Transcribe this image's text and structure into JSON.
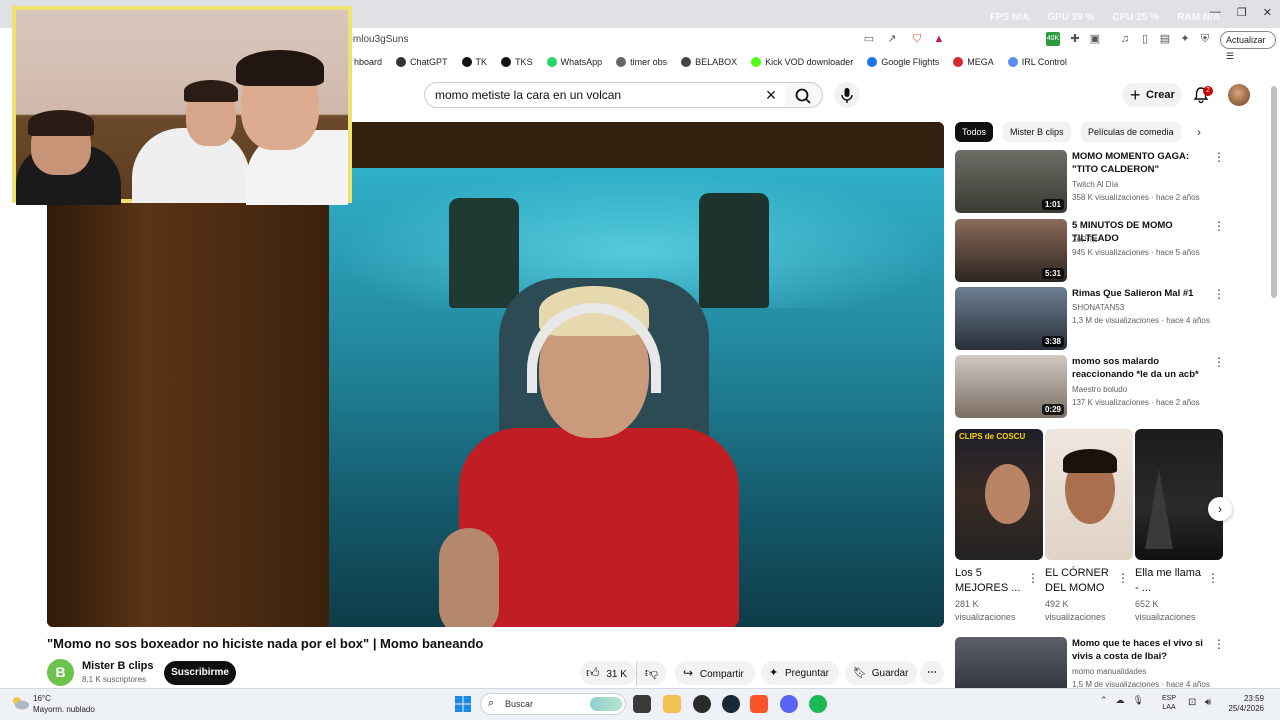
{
  "browser": {
    "url": "e-mlou3gSuns",
    "update_label": "Actualizar",
    "hud": [
      "FPS N/A",
      "GPU 39 %",
      "CPU 25 %",
      "RAM N/A"
    ],
    "bookmarks": [
      {
        "label": "hboard",
        "color": "#888888"
      },
      {
        "label": "ChatGPT",
        "color": "#333333"
      },
      {
        "label": "TK",
        "color": "#111111"
      },
      {
        "label": "TKS",
        "color": "#111111"
      },
      {
        "label": "WhatsApp",
        "color": "#25d366"
      },
      {
        "label": "timer obs",
        "color": "#666666"
      },
      {
        "label": "BELABOX",
        "color": "#444444"
      },
      {
        "label": "Kick VOD downloader",
        "color": "#53fc18"
      },
      {
        "label": "Google Flights",
        "color": "#1a73e8"
      },
      {
        "label": "MEGA",
        "color": "#d9272e"
      },
      {
        "label": "IRL Control",
        "color": "#5a8dee"
      }
    ]
  },
  "header": {
    "search_query": "momo metiste la cara en un volcan",
    "create_label": "Crear",
    "notifications_count": "2"
  },
  "video": {
    "title": "\"Momo no sos boxeador no hiciste nada por el box\" | Momo baneando",
    "channel_name": "Mister B clips",
    "channel_initial": "B",
    "subscribers": "8,1 K suscriptores",
    "subscribe_label": "Suscribirme",
    "likes": "31 K",
    "share_label": "Compartir",
    "ask_label": "Preguntar",
    "save_label": "Guardar"
  },
  "sidebar": {
    "chips": [
      "Todos",
      "Mister B clips",
      "Películas de comedia"
    ],
    "recommendations": [
      {
        "title": "MOMO MOMENTO GAGA: \"TITO CALDERON\"",
        "channel": "Twitch Al Día",
        "meta": "358 K visualizaciones · hace 2 años",
        "duration": "1:01"
      },
      {
        "title": "5 MINUTOS DE MOMO TILTEADO",
        "channel": "ZoPiTa",
        "meta": "945 K visualizaciones · hace 5 años",
        "duration": "5:31"
      },
      {
        "title": "Rimas Que Salieron Mal #1",
        "channel": "SHONATAN53",
        "meta": "1,3 M de visualizaciones · hace 4 años",
        "duration": "3:38"
      },
      {
        "title": "momo sos malardo reaccionando *le da un acb*",
        "channel": "Maestro boludo",
        "meta": "137 K visualizaciones · hace 2 años",
        "duration": "0:29"
      }
    ],
    "shorts": [
      {
        "title": "Los 5 MEJORES ...",
        "views": "281 K visualizaciones",
        "overlay": "CLIPS de COSCU"
      },
      {
        "title": "EL CÓRNER DEL MOMO",
        "views": "492 K visualizaciones"
      },
      {
        "title": "Ella me llama - ...",
        "views": "652 K visualizaciones"
      }
    ],
    "last_recommendation": {
      "title": "Momo que te haces el vivo si vivis a costa de Ibai?",
      "channel": "momo manualidades",
      "meta": "1,5 M de visualizaciones · hace 4 años"
    }
  },
  "taskbar": {
    "temperature": "16°C",
    "weather": "Mayorm. nublado",
    "search_placeholder": "Buscar",
    "lang_top": "ESP",
    "lang_bottom": "LAA",
    "time": "23:59",
    "date": "25/4/2026"
  }
}
